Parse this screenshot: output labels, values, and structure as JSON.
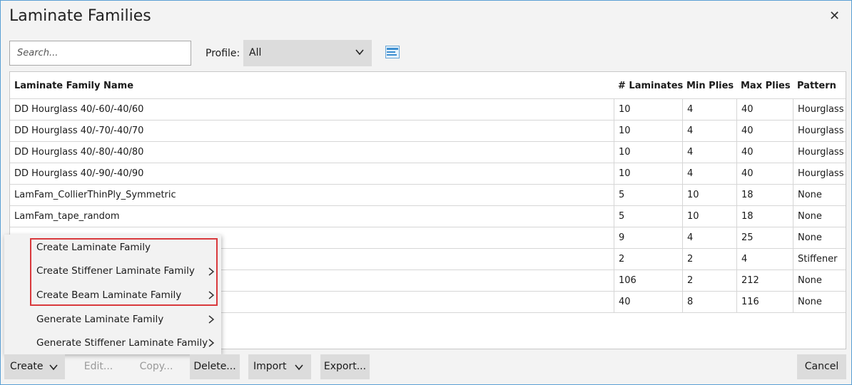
{
  "window": {
    "title": "Laminate Families",
    "close_label": "✕"
  },
  "search": {
    "placeholder": "Search..."
  },
  "profile": {
    "label": "Profile:",
    "value": "All"
  },
  "icons": {
    "chevron": "chevron-down-icon",
    "layout": "column-layout-icon"
  },
  "table": {
    "headers": [
      "Laminate Family Name",
      "# Laminates",
      "Min Plies",
      "Max Plies",
      "Pattern"
    ],
    "rows": [
      [
        "DD Hourglass 40/-60/-40/60",
        "10",
        "4",
        "40",
        "Hourglass"
      ],
      [
        "DD Hourglass 40/-70/-40/70",
        "10",
        "4",
        "40",
        "Hourglass"
      ],
      [
        "DD Hourglass 40/-80/-40/80",
        "10",
        "4",
        "40",
        "Hourglass"
      ],
      [
        "DD Hourglass 40/-90/-40/90",
        "10",
        "4",
        "40",
        "Hourglass"
      ],
      [
        "LamFam_CollierThinPly_Symmetric",
        "5",
        "10",
        "18",
        "None"
      ],
      [
        "LamFam_tape_random",
        "5",
        "10",
        "18",
        "None"
      ],
      [
        "",
        "9",
        "4",
        "25",
        "None"
      ],
      [
        "",
        "2",
        "2",
        "4",
        "Stiffener"
      ],
      [
        "",
        "106",
        "2",
        "212",
        "None"
      ],
      [
        "",
        "40",
        "8",
        "116",
        "None"
      ]
    ]
  },
  "context_menu": {
    "items": [
      {
        "label": "Create Laminate Family",
        "submenu": false
      },
      {
        "label": "Create Stiffener Laminate Family",
        "submenu": true
      },
      {
        "label": "Create Beam Laminate Family",
        "submenu": true
      },
      {
        "label": "Generate Laminate Family",
        "submenu": true
      },
      {
        "label": "Generate Stiffener Laminate Family",
        "submenu": true
      }
    ]
  },
  "buttons": {
    "create": "Create",
    "edit": "Edit...",
    "copy": "Copy...",
    "delete": "Delete...",
    "import": "Import",
    "export": "Export...",
    "cancel": "Cancel"
  },
  "colors": {
    "highlight_border": "#d9393c",
    "window_border": "#5a9fd4"
  }
}
